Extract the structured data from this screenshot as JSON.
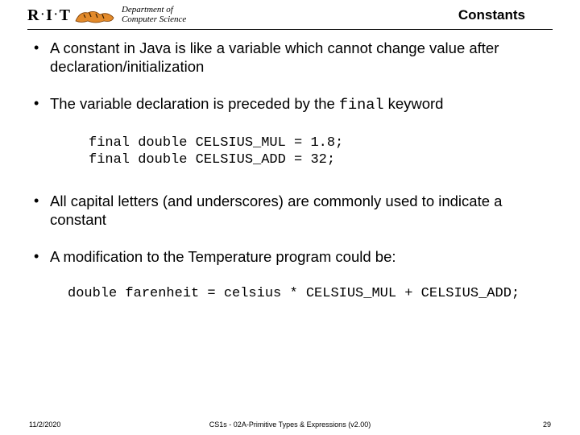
{
  "header": {
    "rit": "R·I·T",
    "dept_line1": "Department of",
    "dept_line2": "Computer Science",
    "title": "Constants"
  },
  "bullets": {
    "b1": "A constant in Java is like a variable which cannot change value after declaration/initialization",
    "b2_a": "The variable declaration is preceded by the ",
    "b2_code": "final",
    "b2_b": " keyword",
    "code1_l1": "final double CELSIUS_MUL = 1.8;",
    "code1_l2": "final double CELSIUS_ADD = 32;",
    "b3": "All capital letters (and underscores) are commonly used to indicate a constant",
    "b4": "A modification to the Temperature program could be:",
    "code2": "double farenheit = celsius * CELSIUS_MUL + CELSIUS_ADD;"
  },
  "footer": {
    "date": "11/2/2020",
    "center": "CS1s - 02A-Primitive Types & Expressions (v2.00)",
    "page": "29"
  }
}
